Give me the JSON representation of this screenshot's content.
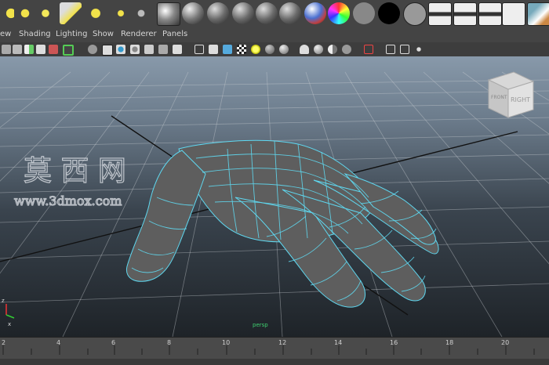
{
  "menu": {
    "items": [
      "ew",
      "Shading",
      "Lighting",
      "Show",
      "Renderer",
      "Panels"
    ]
  },
  "shelf": {
    "icons": [
      "spot-light-icon",
      "directional-light-icon",
      "point-light-icon",
      "spotlight-cone-icon",
      "area-light-icon",
      "volume-light-icon",
      "light-rig-icon",
      "gray-sphere-icon",
      "gray-sphere-icon",
      "gray-sphere-icon",
      "gray-sphere-icon",
      "gray-sphere-icon",
      "gray-sphere-icon",
      "ramp-shader-icon",
      "rainbow-shader-icon",
      "gray-circle-icon",
      "black-circle-icon",
      "gray-circle-icon",
      "clapper-icon",
      "clapper-icon",
      "clapper-batch-icon",
      "checklist-icon",
      "render-view-icon"
    ]
  },
  "viewcube": {
    "front_label": "FRONT",
    "right_label": "RIGHT"
  },
  "watermark": {
    "chinese": "莫 西 网",
    "url": "www.3dmox.com"
  },
  "viewport": {
    "camera_label": "persp"
  },
  "axis_gizmo": {
    "z_label": "z",
    "x_label": "x"
  },
  "timeline": {
    "ticks": [
      "2",
      "4",
      "6",
      "8",
      "10",
      "12",
      "14",
      "16",
      "18",
      "20"
    ]
  },
  "colors": {
    "wireframe": "#5fd8f0",
    "mesh": "#5e5e5e",
    "horizon": "#8899aa",
    "floor": "#1e2328"
  }
}
